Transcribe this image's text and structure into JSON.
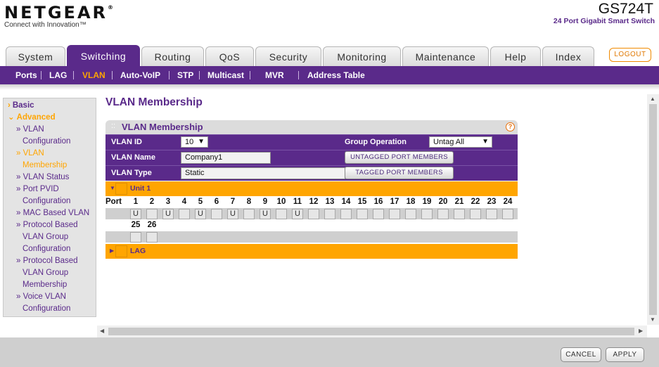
{
  "header": {
    "brand": "NETGEAR",
    "tagline": "Connect with Innovation™",
    "model": "GS724T",
    "model_desc": "24 Port Gigabit Smart Switch"
  },
  "tabs": [
    {
      "label": "System"
    },
    {
      "label": "Switching",
      "active": true
    },
    {
      "label": "Routing"
    },
    {
      "label": "QoS"
    },
    {
      "label": "Security"
    },
    {
      "label": "Monitoring"
    },
    {
      "label": "Maintenance"
    },
    {
      "label": "Help"
    },
    {
      "label": "Index"
    }
  ],
  "logout_label": "LOGOUT",
  "subnav": [
    "Ports",
    "LAG",
    "VLAN",
    "Auto-VoIP",
    "STP",
    "Multicast",
    "MVR",
    "Address Table"
  ],
  "leftmenu": {
    "basic": "Basic",
    "advanced": "Advanced",
    "items": [
      {
        "line1": "» VLAN",
        "line2": "Configuration"
      },
      {
        "line1": "» VLAN",
        "line2": "Membership"
      },
      {
        "line1": "» VLAN Status"
      },
      {
        "line1": "» Port PVID",
        "line2": "Configuration"
      },
      {
        "line1": "» MAC Based VLAN"
      },
      {
        "line1": "» Protocol Based",
        "line2": "VLAN Group",
        "line3": "Configuration"
      },
      {
        "line1": "» Protocol Based",
        "line2": "VLAN Group",
        "line3": "Membership"
      },
      {
        "line1": "» Voice VLAN",
        "line2": "Configuration"
      }
    ]
  },
  "page_title": "VLAN Membership",
  "panel": {
    "title": "VLAN Membership",
    "help": "?",
    "vlan_id_label": "VLAN ID",
    "vlan_id_value": "10",
    "group_op_label": "Group Operation",
    "group_op_value": "Untag All",
    "vlan_name_label": "VLAN Name",
    "vlan_name_value": "Company1",
    "vlan_type_label": "VLAN Type",
    "vlan_type_value": "Static",
    "untagged_btn": "UNTAGGED PORT MEMBERS",
    "tagged_btn": "TAGGED PORT MEMBERS",
    "unit_label": "Unit 1",
    "port_word": "Port",
    "lag_label": "LAG"
  },
  "ports_row1": [
    {
      "n": "1",
      "v": "U"
    },
    {
      "n": "2",
      "v": ""
    },
    {
      "n": "3",
      "v": "U"
    },
    {
      "n": "4",
      "v": ""
    },
    {
      "n": "5",
      "v": "U"
    },
    {
      "n": "6",
      "v": ""
    },
    {
      "n": "7",
      "v": "U"
    },
    {
      "n": "8",
      "v": ""
    },
    {
      "n": "9",
      "v": "U"
    },
    {
      "n": "10",
      "v": ""
    },
    {
      "n": "11",
      "v": "U"
    },
    {
      "n": "12",
      "v": ""
    },
    {
      "n": "13",
      "v": ""
    },
    {
      "n": "14",
      "v": ""
    },
    {
      "n": "15",
      "v": ""
    },
    {
      "n": "16",
      "v": ""
    },
    {
      "n": "17",
      "v": ""
    },
    {
      "n": "18",
      "v": ""
    },
    {
      "n": "19",
      "v": ""
    },
    {
      "n": "20",
      "v": ""
    },
    {
      "n": "21",
      "v": ""
    },
    {
      "n": "22",
      "v": ""
    },
    {
      "n": "23",
      "v": ""
    },
    {
      "n": "24",
      "v": ""
    }
  ],
  "ports_row2": [
    {
      "n": "25",
      "v": ""
    },
    {
      "n": "26",
      "v": ""
    }
  ],
  "footer": {
    "cancel": "CANCEL",
    "apply": "APPLY"
  }
}
